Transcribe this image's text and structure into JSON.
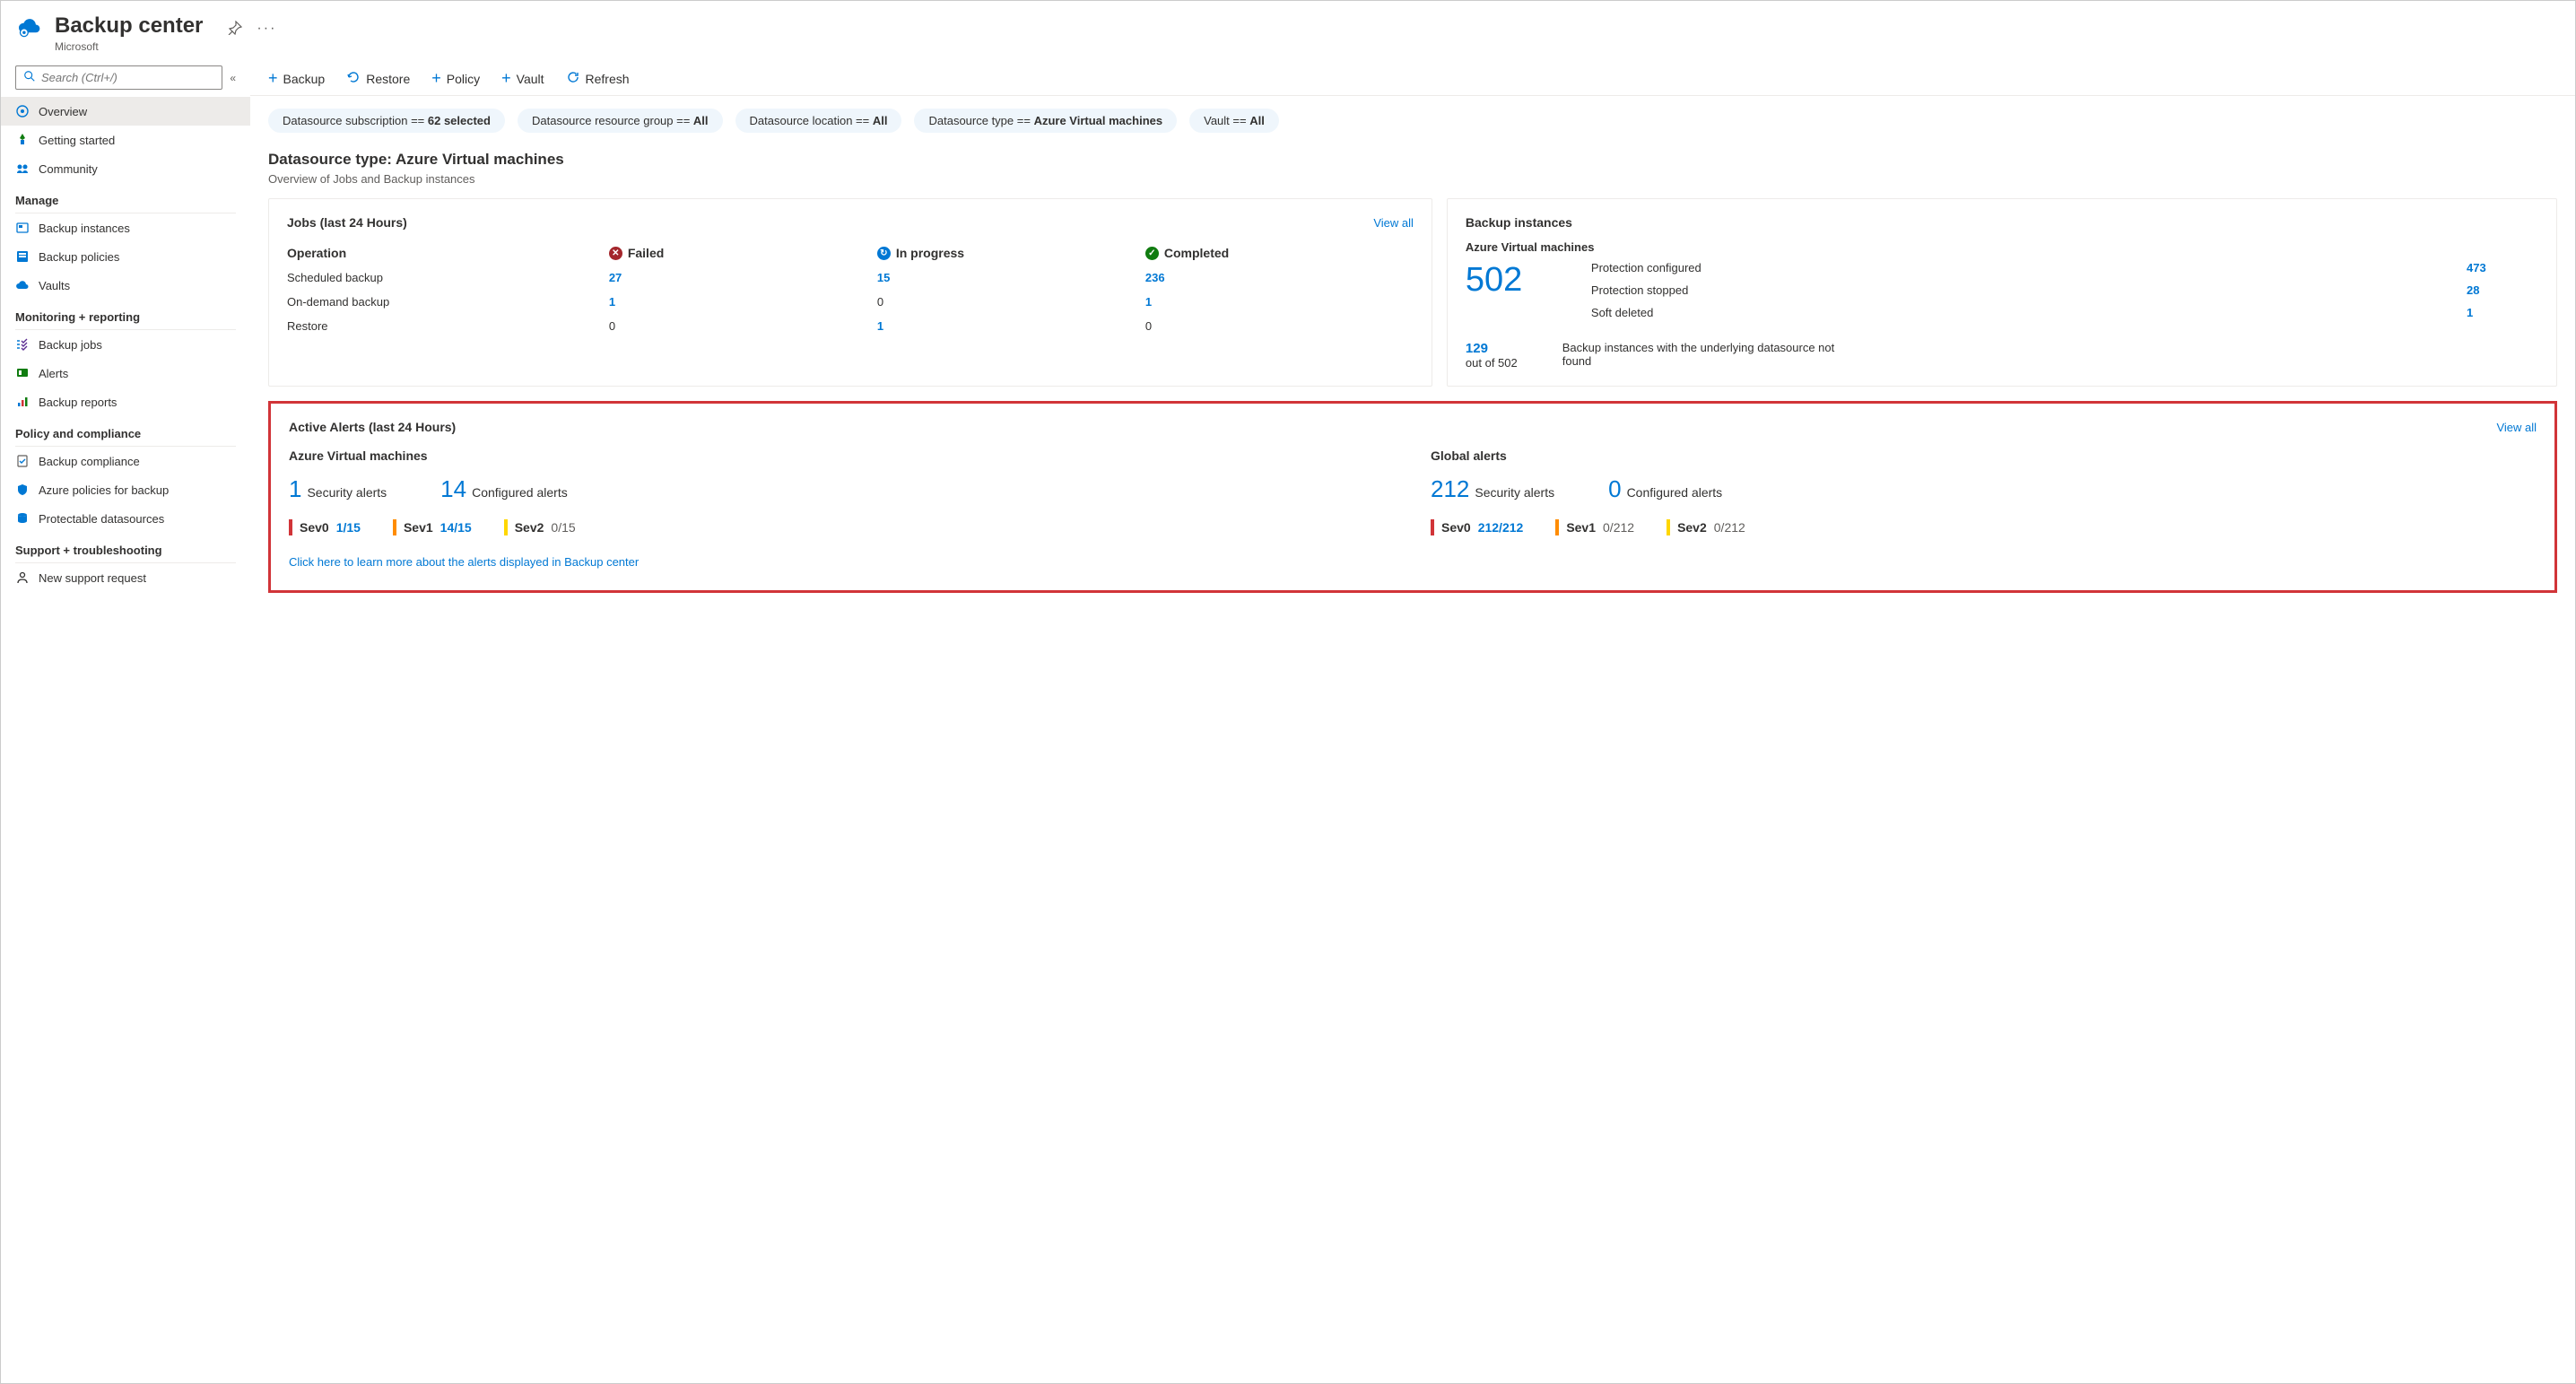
{
  "header": {
    "title": "Backup center",
    "subtitle": "Microsoft"
  },
  "search": {
    "placeholder": "Search (Ctrl+/)"
  },
  "nav": {
    "top": [
      {
        "label": "Overview"
      },
      {
        "label": "Getting started"
      },
      {
        "label": "Community"
      }
    ],
    "groups": [
      {
        "title": "Manage",
        "items": [
          "Backup instances",
          "Backup policies",
          "Vaults"
        ]
      },
      {
        "title": "Monitoring + reporting",
        "items": [
          "Backup jobs",
          "Alerts",
          "Backup reports"
        ]
      },
      {
        "title": "Policy and compliance",
        "items": [
          "Backup compliance",
          "Azure policies for backup",
          "Protectable datasources"
        ]
      },
      {
        "title": "Support + troubleshooting",
        "items": [
          "New support request"
        ]
      }
    ]
  },
  "toolbar": {
    "backup": "Backup",
    "restore": "Restore",
    "policy": "Policy",
    "vault": "Vault",
    "refresh": "Refresh"
  },
  "filters": {
    "subscription_prefix": "Datasource subscription == ",
    "subscription_val": "62 selected",
    "rg_prefix": "Datasource resource group == ",
    "rg_val": "All",
    "loc_prefix": "Datasource location == ",
    "loc_val": "All",
    "type_prefix": "Datasource type == ",
    "type_val": "Azure Virtual machines",
    "vault_prefix": "Vault == ",
    "vault_val": "All"
  },
  "section": {
    "title": "Datasource type: Azure Virtual machines",
    "sub": "Overview of Jobs and Backup instances"
  },
  "jobs": {
    "title": "Jobs (last 24 Hours)",
    "view_all": "View all",
    "col_op": "Operation",
    "col_failed": "Failed",
    "col_inprogress": "In progress",
    "col_completed": "Completed",
    "rows": [
      {
        "op": "Scheduled backup",
        "failed": "27",
        "inprogress": "15",
        "completed": "236"
      },
      {
        "op": "On-demand backup",
        "failed": "1",
        "inprogress": "0",
        "completed": "1"
      },
      {
        "op": "Restore",
        "failed": "0",
        "inprogress": "1",
        "completed": "0"
      }
    ]
  },
  "backup_instances": {
    "title": "Backup instances",
    "subtitle": "Azure Virtual machines",
    "total": "502",
    "rows": [
      {
        "label": "Protection configured",
        "val": "473"
      },
      {
        "label": "Protection stopped",
        "val": "28"
      },
      {
        "label": "Soft deleted",
        "val": "1"
      }
    ],
    "not_found_count": "129",
    "not_found_sub": "out of 502",
    "not_found_text": "Backup instances with the underlying datasource not found"
  },
  "alerts": {
    "title": "Active Alerts (last 24 Hours)",
    "view_all": "View all",
    "col1_title": "Azure Virtual machines",
    "col2_title": "Global alerts",
    "col1_security_n": "1",
    "col1_security_l": "Security alerts",
    "col1_conf_n": "14",
    "col1_conf_l": "Configured alerts",
    "col2_security_n": "212",
    "col2_security_l": "Security alerts",
    "col2_conf_n": "0",
    "col2_conf_l": "Configured alerts",
    "sev0": "Sev0",
    "sev1": "Sev1",
    "sev2": "Sev2",
    "col1_sev0": "1/15",
    "col1_sev1": "14/15",
    "col1_sev2": "0/15",
    "col2_sev0": "212/212",
    "col2_sev1": "0/212",
    "col2_sev2": "0/212",
    "footer_link": "Click here to learn more about the alerts displayed in Backup center"
  }
}
